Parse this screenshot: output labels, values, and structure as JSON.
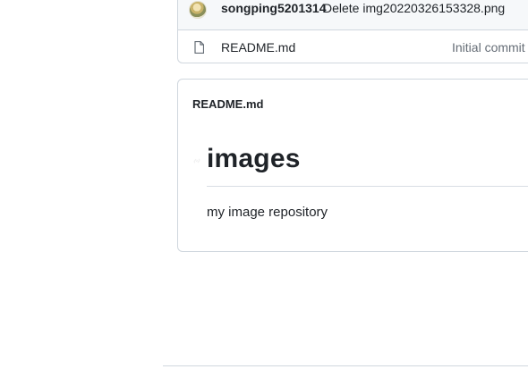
{
  "latest_commit": {
    "author": "songping5201314",
    "message": "Delete img20220326153328.png",
    "avatar_icon": "user-avatar"
  },
  "files": [
    {
      "icon": "file-icon",
      "name": "README.md",
      "last_commit": "Initial commit"
    }
  ],
  "readme": {
    "title": "README.md",
    "heading": "images",
    "paragraph": "my image repository",
    "anchor_icon": "link-icon"
  },
  "colors": {
    "border": "#d0d7de",
    "header_bg": "#f6f8fa",
    "text": "#1f2328",
    "muted_text": "#656d76"
  }
}
